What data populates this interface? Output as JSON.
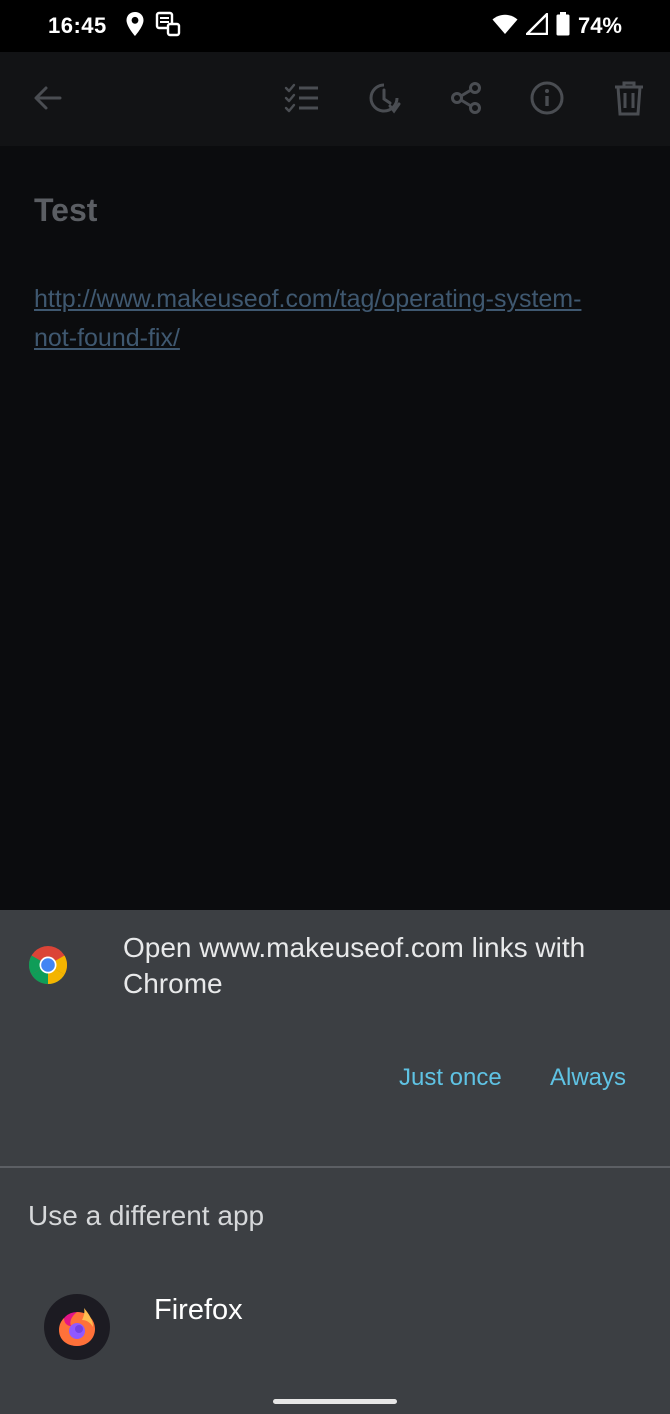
{
  "status_bar": {
    "time": "16:45",
    "battery": "74%",
    "icons": [
      "location-icon",
      "notification-icon",
      "wifi-icon",
      "signal-icon",
      "battery-icon"
    ]
  },
  "toolbar": {
    "icons": [
      "back-arrow-icon",
      "checklist-icon",
      "reminder-icon",
      "share-icon",
      "info-icon",
      "delete-icon"
    ]
  },
  "note": {
    "title": "Test",
    "link": "http://www.makeuseof.com/tag/operating-system-not-found-fix/"
  },
  "dialog": {
    "title": "Open www.makeuseof.com links with Chrome",
    "just_once": "Just once",
    "always": "Always",
    "section_title": "Use a different app",
    "apps": [
      {
        "label": "Firefox",
        "icon": "firefox-icon"
      }
    ],
    "accent": "#5fc3e4"
  }
}
